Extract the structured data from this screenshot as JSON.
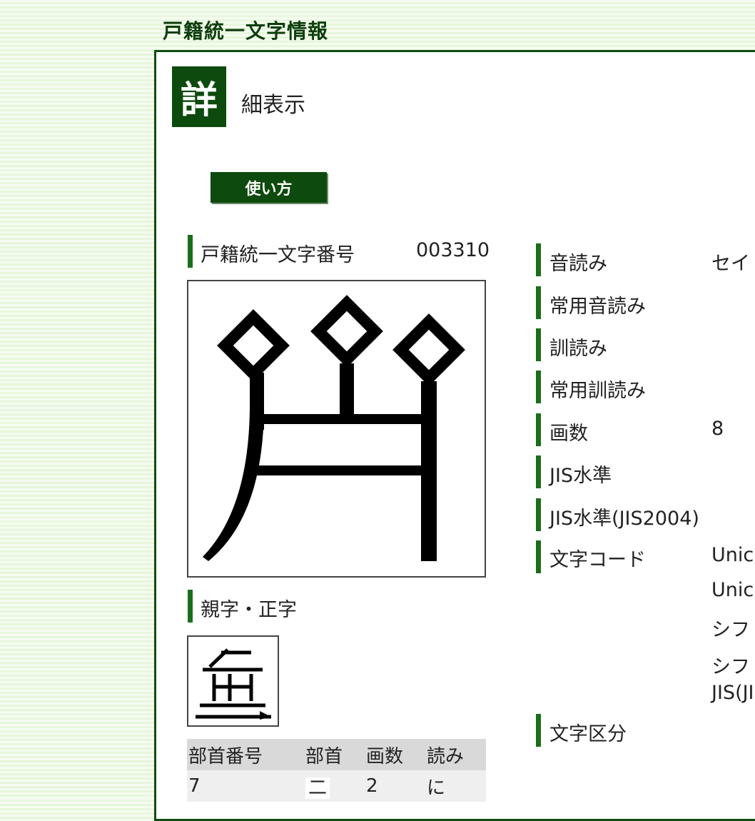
{
  "site_title": "戸籍統一文字情報",
  "heading": {
    "badge": "詳",
    "rest": "細表示"
  },
  "howto_button": "使い方",
  "char_number": {
    "label": "戸籍統一文字番号",
    "value": "003310"
  },
  "parent": {
    "label": "親字・正字"
  },
  "radical_table": {
    "headers": [
      "部首番号",
      "部首",
      "画数",
      "読み"
    ],
    "row": [
      "7",
      "二",
      "2",
      "に"
    ]
  },
  "readings": [
    {
      "label": "音読み",
      "value": "セイ"
    },
    {
      "label": "常用音読み",
      "value": ""
    },
    {
      "label": "訓読み",
      "value": ""
    },
    {
      "label": "常用訓読み",
      "value": ""
    },
    {
      "label": "画数",
      "value": "8"
    },
    {
      "label": "JIS水準",
      "value": ""
    },
    {
      "label": "JIS水準(JIS2004)",
      "value": ""
    },
    {
      "label": "文字コード",
      "value": "Unic"
    },
    {
      "label": "文字区分",
      "value": ""
    }
  ],
  "code_lines": [
    "Unic",
    "シフ",
    "シフ",
    "JIS(JI"
  ],
  "icons": {
    "char_glyph": "kanji-glyph-icon",
    "parent_glyph": "parent-glyph-icon"
  },
  "colors": {
    "accent": "#0d4a0d",
    "bar": "#1a6e1a",
    "page_bg": "#f6fcf1"
  }
}
